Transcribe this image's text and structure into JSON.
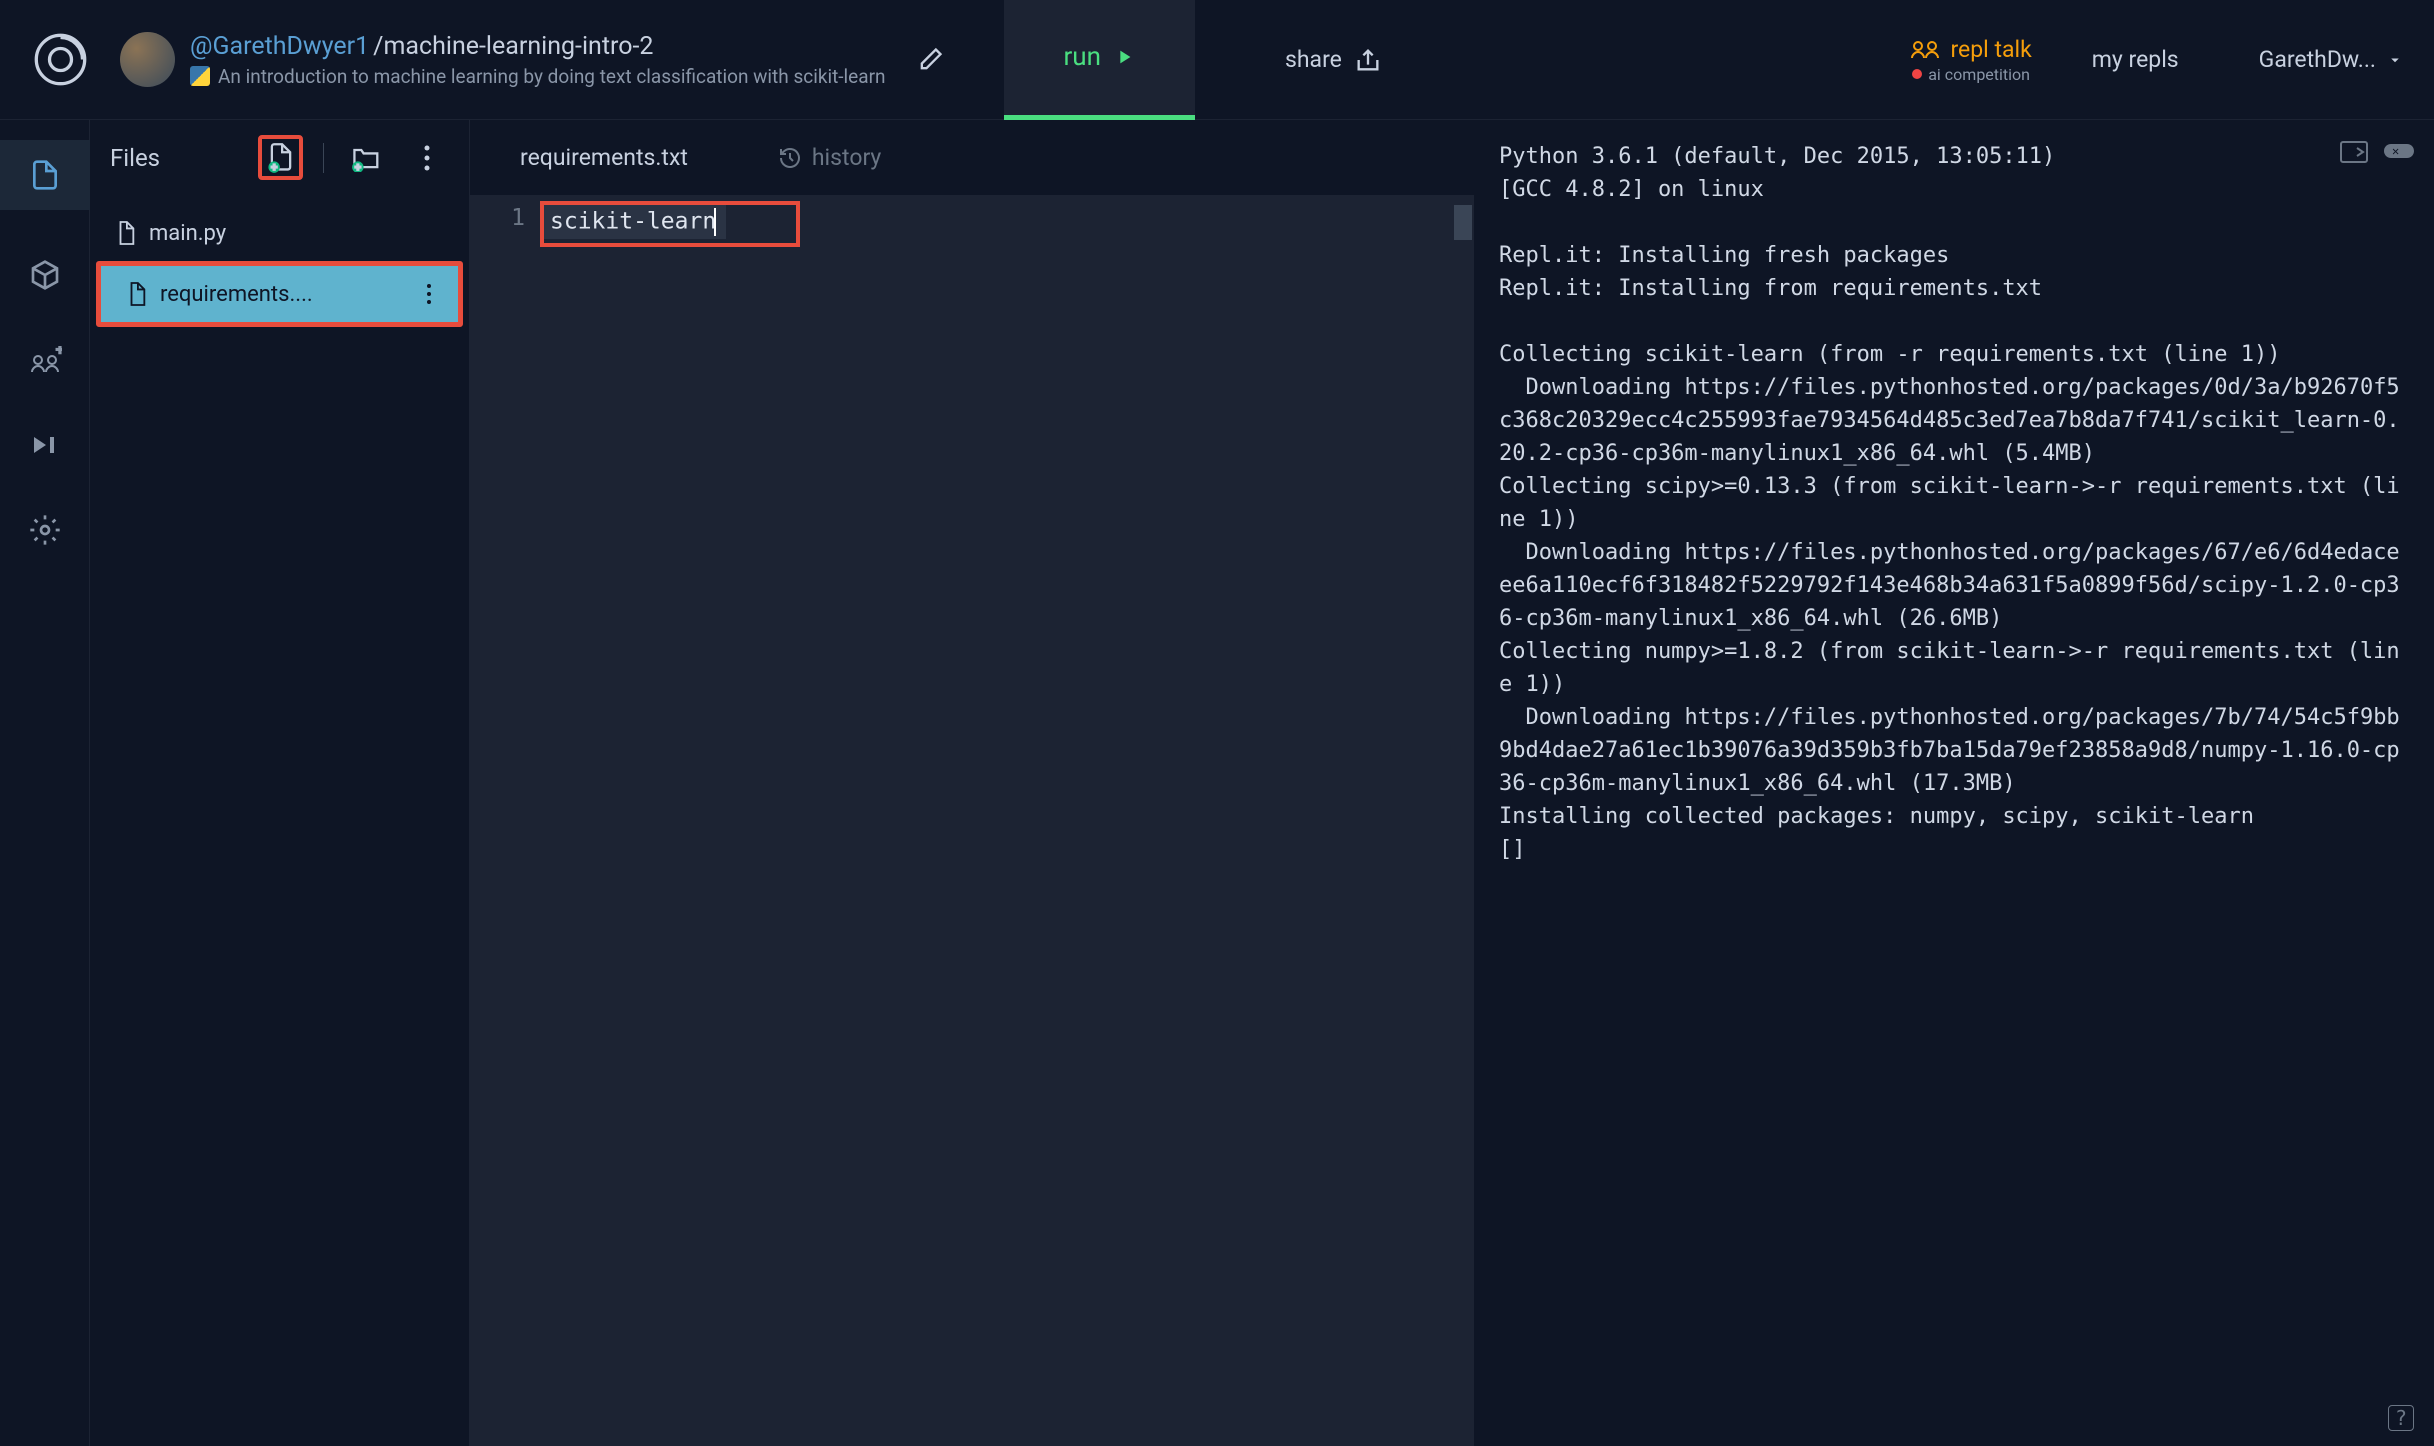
{
  "header": {
    "username": "@GarethDwyer1",
    "reponame": "/machine-learning-intro-2",
    "description": "An introduction to machine learning by doing text classification with scikit-learn",
    "run_label": "run",
    "share_label": "share",
    "repltalk_label": "repl talk",
    "repltalk_sub": "ai competition",
    "myrepls_label": "my repls",
    "user_display": "GarethDw..."
  },
  "files": {
    "title": "Files",
    "items": [
      {
        "name": "main.py"
      },
      {
        "name": "requirements...."
      }
    ]
  },
  "tabs": {
    "active": "requirements.txt",
    "history": "history"
  },
  "editor": {
    "line_no": "1",
    "content": "scikit-learn"
  },
  "console": {
    "lines": [
      "Python 3.6.1 (default, Dec 2015, 13:05:11)",
      "[GCC 4.8.2] on linux",
      "",
      "Repl.it: Installing fresh packages",
      "Repl.it: Installing from requirements.txt",
      "",
      "Collecting scikit-learn (from -r requirements.txt (line 1))",
      "  Downloading https://files.pythonhosted.org/packages/0d/3a/b92670f5c368c20329ecc4c255993fae7934564d485c3ed7ea7b8da7f741/scikit_learn-0.20.2-cp36-cp36m-manylinux1_x86_64.whl (5.4MB)",
      "Collecting scipy>=0.13.3 (from scikit-learn->-r requirements.txt (line 1))",
      "  Downloading https://files.pythonhosted.org/packages/67/e6/6d4edaceee6a110ecf6f318482f5229792f143e468b34a631f5a0899f56d/scipy-1.2.0-cp36-cp36m-manylinux1_x86_64.whl (26.6MB)",
      "Collecting numpy>=1.8.2 (from scikit-learn->-r requirements.txt (line 1))",
      "  Downloading https://files.pythonhosted.org/packages/7b/74/54c5f9bb9bd4dae27a61ec1b39076a39d359b3fb7ba15da79ef23858a9d8/numpy-1.16.0-cp36-cp36m-manylinux1_x86_64.whl (17.3MB)",
      "Installing collected packages: numpy, scipy, scikit-learn",
      "[]"
    ]
  }
}
